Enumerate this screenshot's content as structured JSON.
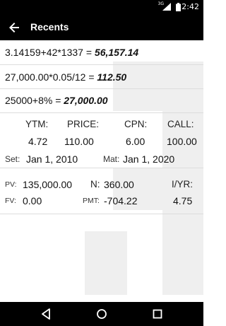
{
  "status": {
    "network": "3G",
    "time": "2:42"
  },
  "appbar": {
    "title": "Recents"
  },
  "recents": [
    {
      "expr": "3.14159+42*1337 = ",
      "result": "56,157.14"
    },
    {
      "expr": "27,000.00*0.05/12 = ",
      "result": "112.50"
    },
    {
      "expr": "25000+8% = ",
      "result": "27,000.00"
    }
  ],
  "bond": {
    "ytm_label": "YTM:",
    "price_label": "PRICE:",
    "cpn_label": "CPN:",
    "call_label": "CALL:",
    "ytm": "4.72",
    "price": "110.00",
    "cpn": "6.00",
    "call": "100.00",
    "set_label": "Set:",
    "set_date": "Jan 1, 2010",
    "mat_label": "Mat:",
    "mat_date": "Jan 1, 2020"
  },
  "tvm": {
    "pv_label": "PV:",
    "pv": "135,000.00",
    "n_label": "N:",
    "n": "360.00",
    "iyr_label": "I/YR:",
    "iyr": "4.75",
    "fv_label": "FV:",
    "fv": "0.00",
    "pmt_label": "PMT:",
    "pmt": "-704.22"
  }
}
